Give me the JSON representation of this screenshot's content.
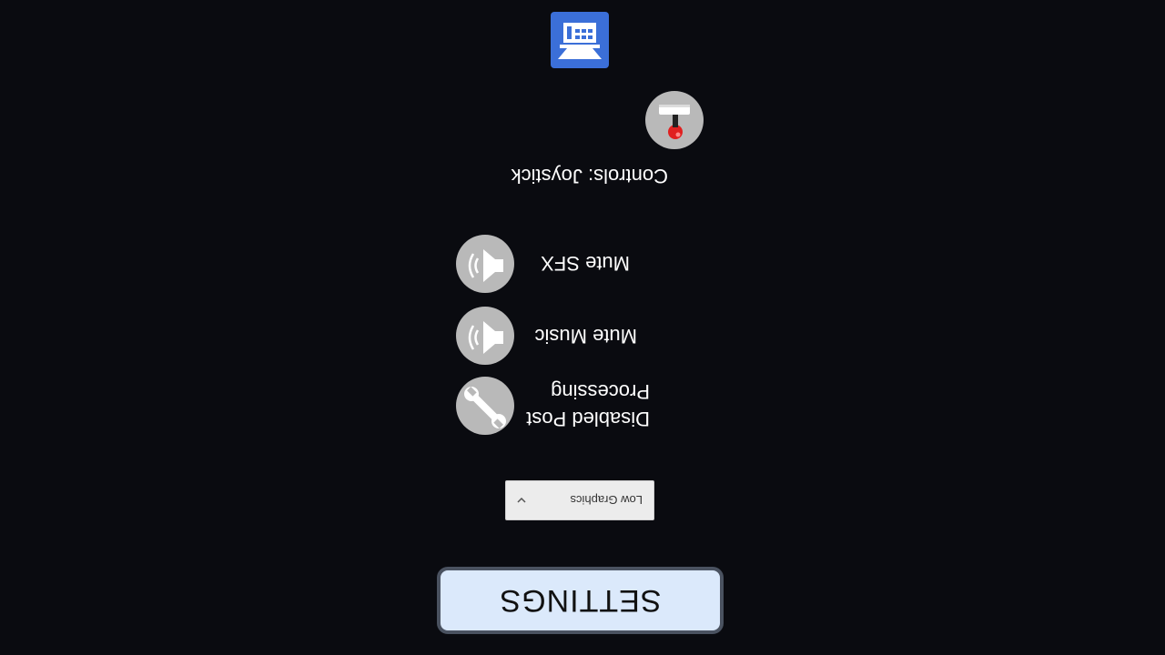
{
  "screen": {
    "title": "SETTINGS",
    "graphics": {
      "selected": "Low Graphics"
    },
    "options": [
      {
        "label": "Disabled Post Processing",
        "icon": "wrench-icon"
      },
      {
        "label": "Mute Music",
        "icon": "speaker-icon"
      },
      {
        "label": "Mute SFX",
        "icon": "speaker-icon"
      }
    ],
    "controls": {
      "label": "Controls: Joystick",
      "icon": "joystick-icon"
    },
    "app_icon": "app-store-icon",
    "orientation": "rotated 180 degrees",
    "colors": {
      "background": "#0a0b10",
      "title_button_bg": "#dbe9fb",
      "title_button_border": "#4a5260",
      "option_icon_bg": "#b9b9b9",
      "app_icon_bg": "#3b6fd8",
      "joystick_ball": "#e02020",
      "text": "#ffffff"
    }
  }
}
